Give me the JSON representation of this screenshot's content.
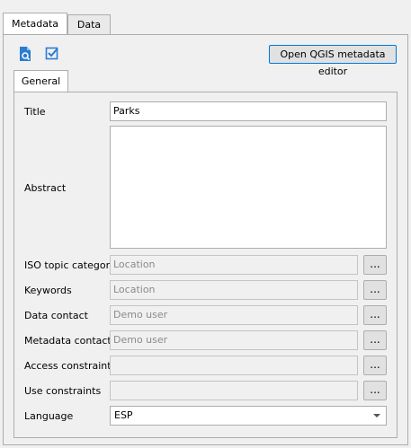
{
  "tabs": [
    {
      "label": "Metadata",
      "active": true
    },
    {
      "label": "Data",
      "active": false
    }
  ],
  "toolbar": {
    "icon1": "search-document-icon",
    "icon2": "checkbox-check-icon",
    "editor_button": "Open QGIS metadata editor"
  },
  "subtabs": [
    {
      "label": "General",
      "active": true
    }
  ],
  "form": {
    "title": {
      "label": "Title",
      "value": "Parks"
    },
    "abstract": {
      "label": "Abstract",
      "value": ""
    },
    "iso": {
      "label": "ISO topic category",
      "value": "Location"
    },
    "keywords": {
      "label": "Keywords",
      "value": "Location"
    },
    "data_contact": {
      "label": "Data contact",
      "value": "Demo user"
    },
    "metadata_contact": {
      "label": "Metadata contact",
      "value": "Demo user"
    },
    "access": {
      "label": "Access constraints",
      "value": ""
    },
    "use": {
      "label": "Use constraints",
      "value": ""
    },
    "language": {
      "label": "Language",
      "value": "ESP"
    },
    "dots_label": "..."
  },
  "colors": {
    "accent": "#0078d7",
    "icon_blue": "#2b7cd3"
  }
}
